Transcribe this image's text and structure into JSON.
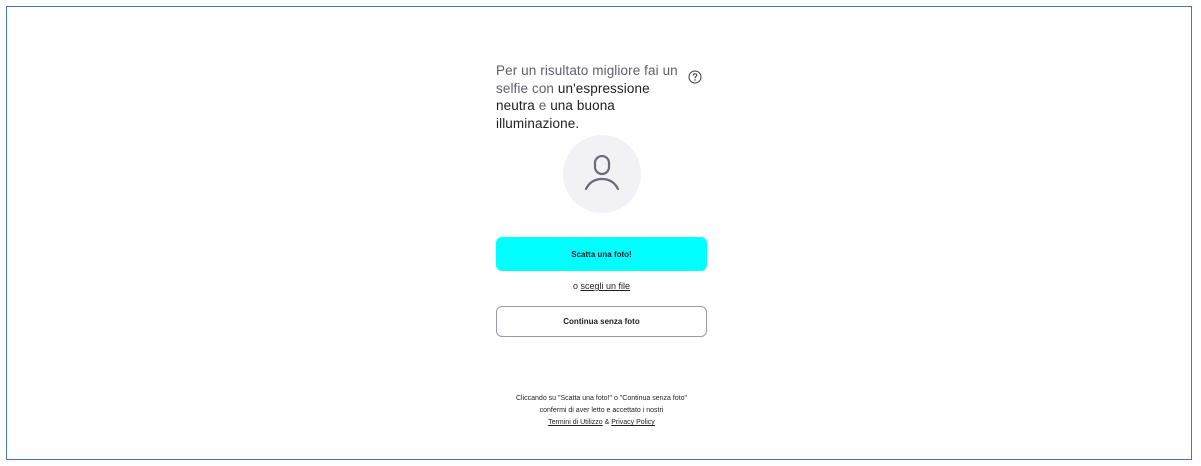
{
  "intro": {
    "text_plain": "Per un risultato migliore fai un selfie con ",
    "text_strong_1": "un'espressione neutra",
    "text_mid": " e ",
    "text_strong_2": "una buona illuminazione."
  },
  "icons": {
    "help": "help-circle-icon",
    "avatar": "user-placeholder-icon"
  },
  "actions": {
    "take_photo_label": "Scatta una foto!",
    "or_prefix": "o ",
    "choose_file_label": "scegli un file",
    "continue_label": "Continua senza foto"
  },
  "legal": {
    "line_1": "Cliccando su \"Scatta una foto!\" o \"Continua senza foto\"",
    "line_2": "confermi di aver letto e accettato i nostri",
    "terms_label": "Termini di Utilizzo",
    "amp": " & ",
    "privacy_label": "Privacy Policy"
  },
  "colors": {
    "primary": "#00ffff",
    "frame_border": "#4a72c4",
    "avatar_bg": "#f1f1f6",
    "text": "#1f1f24"
  }
}
